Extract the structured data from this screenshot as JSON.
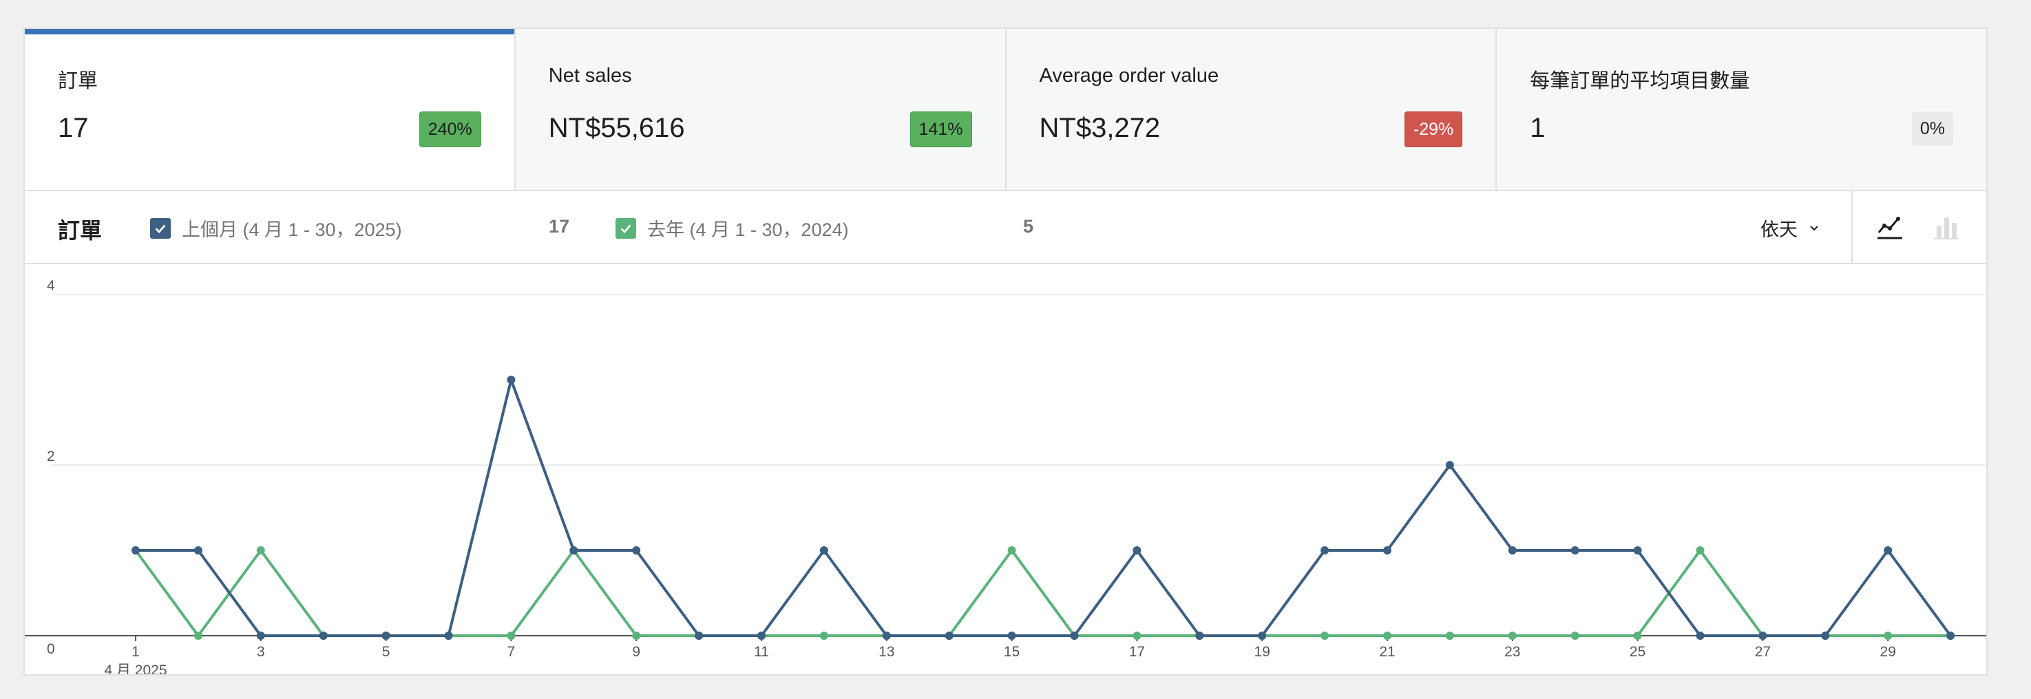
{
  "tiles": [
    {
      "label": "訂單",
      "value": "17",
      "delta": "240%",
      "delta_type": "pos",
      "active": true
    },
    {
      "label": "Net sales",
      "value": "NT$55,616",
      "delta": "141%",
      "delta_type": "pos",
      "active": false
    },
    {
      "label": "Average order value",
      "value": "NT$3,272",
      "delta": "-29%",
      "delta_type": "neg",
      "active": false
    },
    {
      "label": "每筆訂單的平均項目數量",
      "value": "1",
      "delta": "0%",
      "delta_type": "zero",
      "active": false
    }
  ],
  "chart_header": {
    "title": "訂單",
    "current": {
      "label": "上個月 (4 月 1 - 30，2025)",
      "total": "17",
      "color": "#3c5f82"
    },
    "previous": {
      "label": "去年 (4 月 1 - 30，2024)",
      "total": "5",
      "color": "#5ab37a"
    },
    "interval": "依天"
  },
  "chart_data": {
    "type": "line",
    "title": "",
    "xlabel": "",
    "ylabel": "",
    "x": [
      1,
      2,
      3,
      4,
      5,
      6,
      7,
      8,
      9,
      10,
      11,
      12,
      13,
      14,
      15,
      16,
      17,
      18,
      19,
      20,
      21,
      22,
      23,
      24,
      25,
      26,
      27,
      28,
      29,
      30
    ],
    "x_tick_labels": [
      "1",
      "3",
      "5",
      "7",
      "9",
      "11",
      "13",
      "15",
      "17",
      "19",
      "21",
      "23",
      "25",
      "27",
      "29"
    ],
    "x_sub_label": "4 月 2025",
    "y_ticks": [
      "0",
      "2",
      "4"
    ],
    "ylim": [
      0,
      4
    ],
    "grid": true,
    "series": [
      {
        "name": "上個月 (4 月 1 - 30，2025)",
        "color": "#3c5f82",
        "values": [
          1,
          1,
          0,
          0,
          0,
          0,
          3,
          1,
          1,
          0,
          0,
          1,
          0,
          0,
          0,
          0,
          1,
          0,
          0,
          1,
          1,
          2,
          1,
          1,
          1,
          0,
          0,
          0,
          1,
          0
        ]
      },
      {
        "name": "去年 (4 月 1 - 30，2024)",
        "color": "#5ab37a",
        "values": [
          1,
          0,
          1,
          0,
          0,
          0,
          0,
          1,
          0,
          0,
          0,
          0,
          0,
          0,
          1,
          0,
          0,
          0,
          0,
          0,
          0,
          0,
          0,
          0,
          0,
          1,
          0,
          0,
          0,
          0
        ]
      }
    ]
  }
}
